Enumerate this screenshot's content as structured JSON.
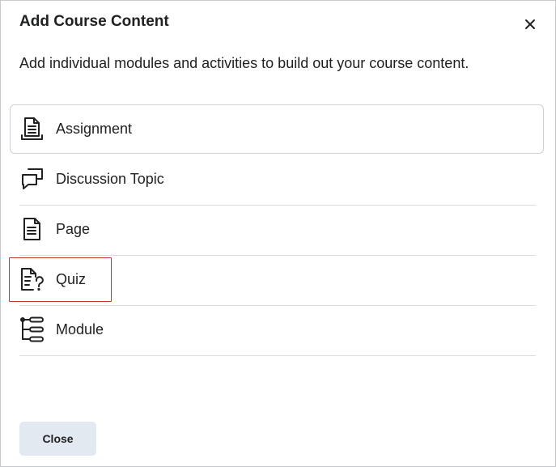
{
  "dialog": {
    "title": "Add Course Content",
    "description": "Add individual modules and activities to build out your course content.",
    "close_icon": "close-icon",
    "close_button_label": "Close"
  },
  "items": [
    {
      "label": "Assignment",
      "icon": "assignment-icon"
    },
    {
      "label": "Discussion Topic",
      "icon": "discussion-icon"
    },
    {
      "label": "Page",
      "icon": "page-icon"
    },
    {
      "label": "Quiz",
      "icon": "quiz-icon",
      "highlighted": true
    },
    {
      "label": "Module",
      "icon": "module-icon"
    }
  ],
  "colors": {
    "text": "#202122",
    "border": "#d9dcde",
    "button_bg": "#e3e9f1",
    "highlight": "#c0392b"
  }
}
